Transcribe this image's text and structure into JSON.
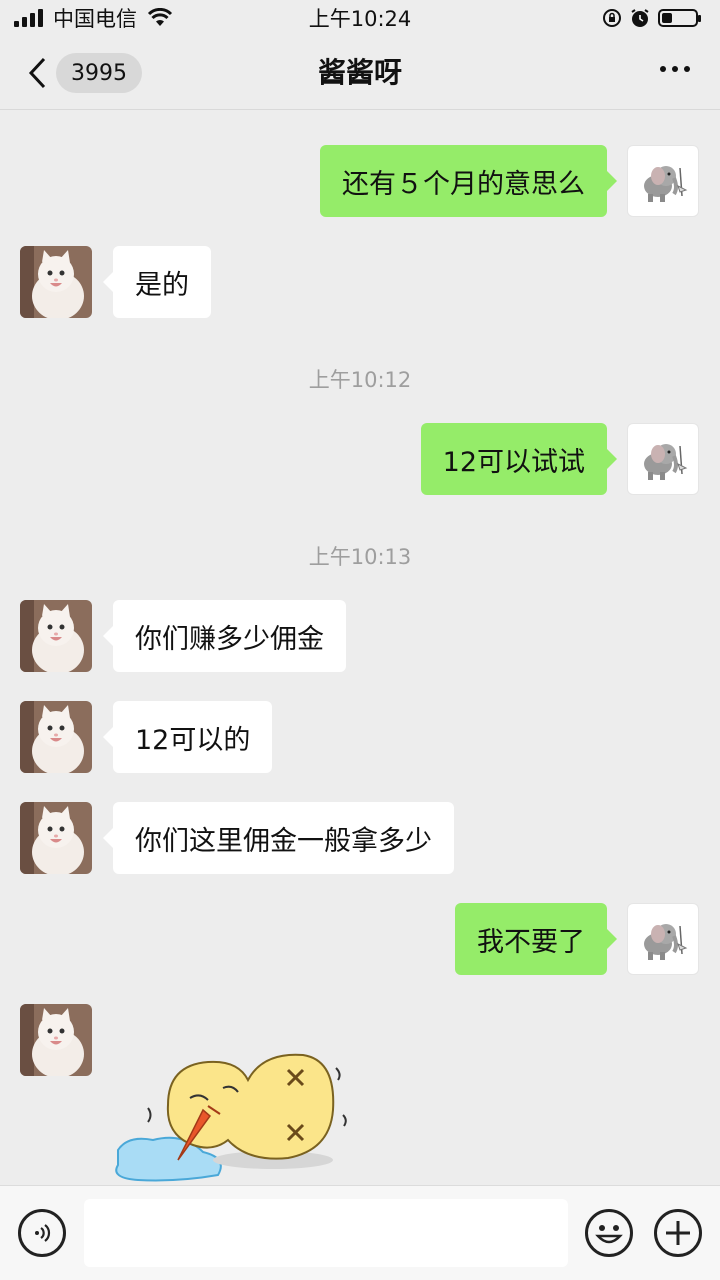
{
  "status_bar": {
    "carrier": "中国电信",
    "time": "上午10:24",
    "signal_bars": 4,
    "battery_level": 0.3
  },
  "nav": {
    "unread_count": "3995",
    "title": "酱酱呀"
  },
  "messages": [
    {
      "side": "right",
      "text": "还有５个月的意思么"
    },
    {
      "side": "left",
      "text": "是的"
    },
    {
      "type": "time",
      "text": "上午10:12"
    },
    {
      "side": "right",
      "text": "12可以试试"
    },
    {
      "type": "time",
      "text": "上午10:13"
    },
    {
      "side": "left",
      "text": "你们赚多少佣金"
    },
    {
      "side": "left",
      "text": "12可以的"
    },
    {
      "side": "left",
      "text": "你们这里佣金一般拿多少"
    },
    {
      "side": "right",
      "text": "我不要了"
    },
    {
      "side": "left",
      "type": "sticker",
      "sticker": "crying-chick-sticker"
    }
  ],
  "avatars": {
    "contact": "white-cat-avatar",
    "self": "elephant-avatar"
  },
  "input_bar": {
    "text_value": ""
  },
  "colors": {
    "background": "#ededed",
    "self_bubble": "#95ec69",
    "other_bubble": "#ffffff",
    "timestamp": "#9e9e9e"
  }
}
